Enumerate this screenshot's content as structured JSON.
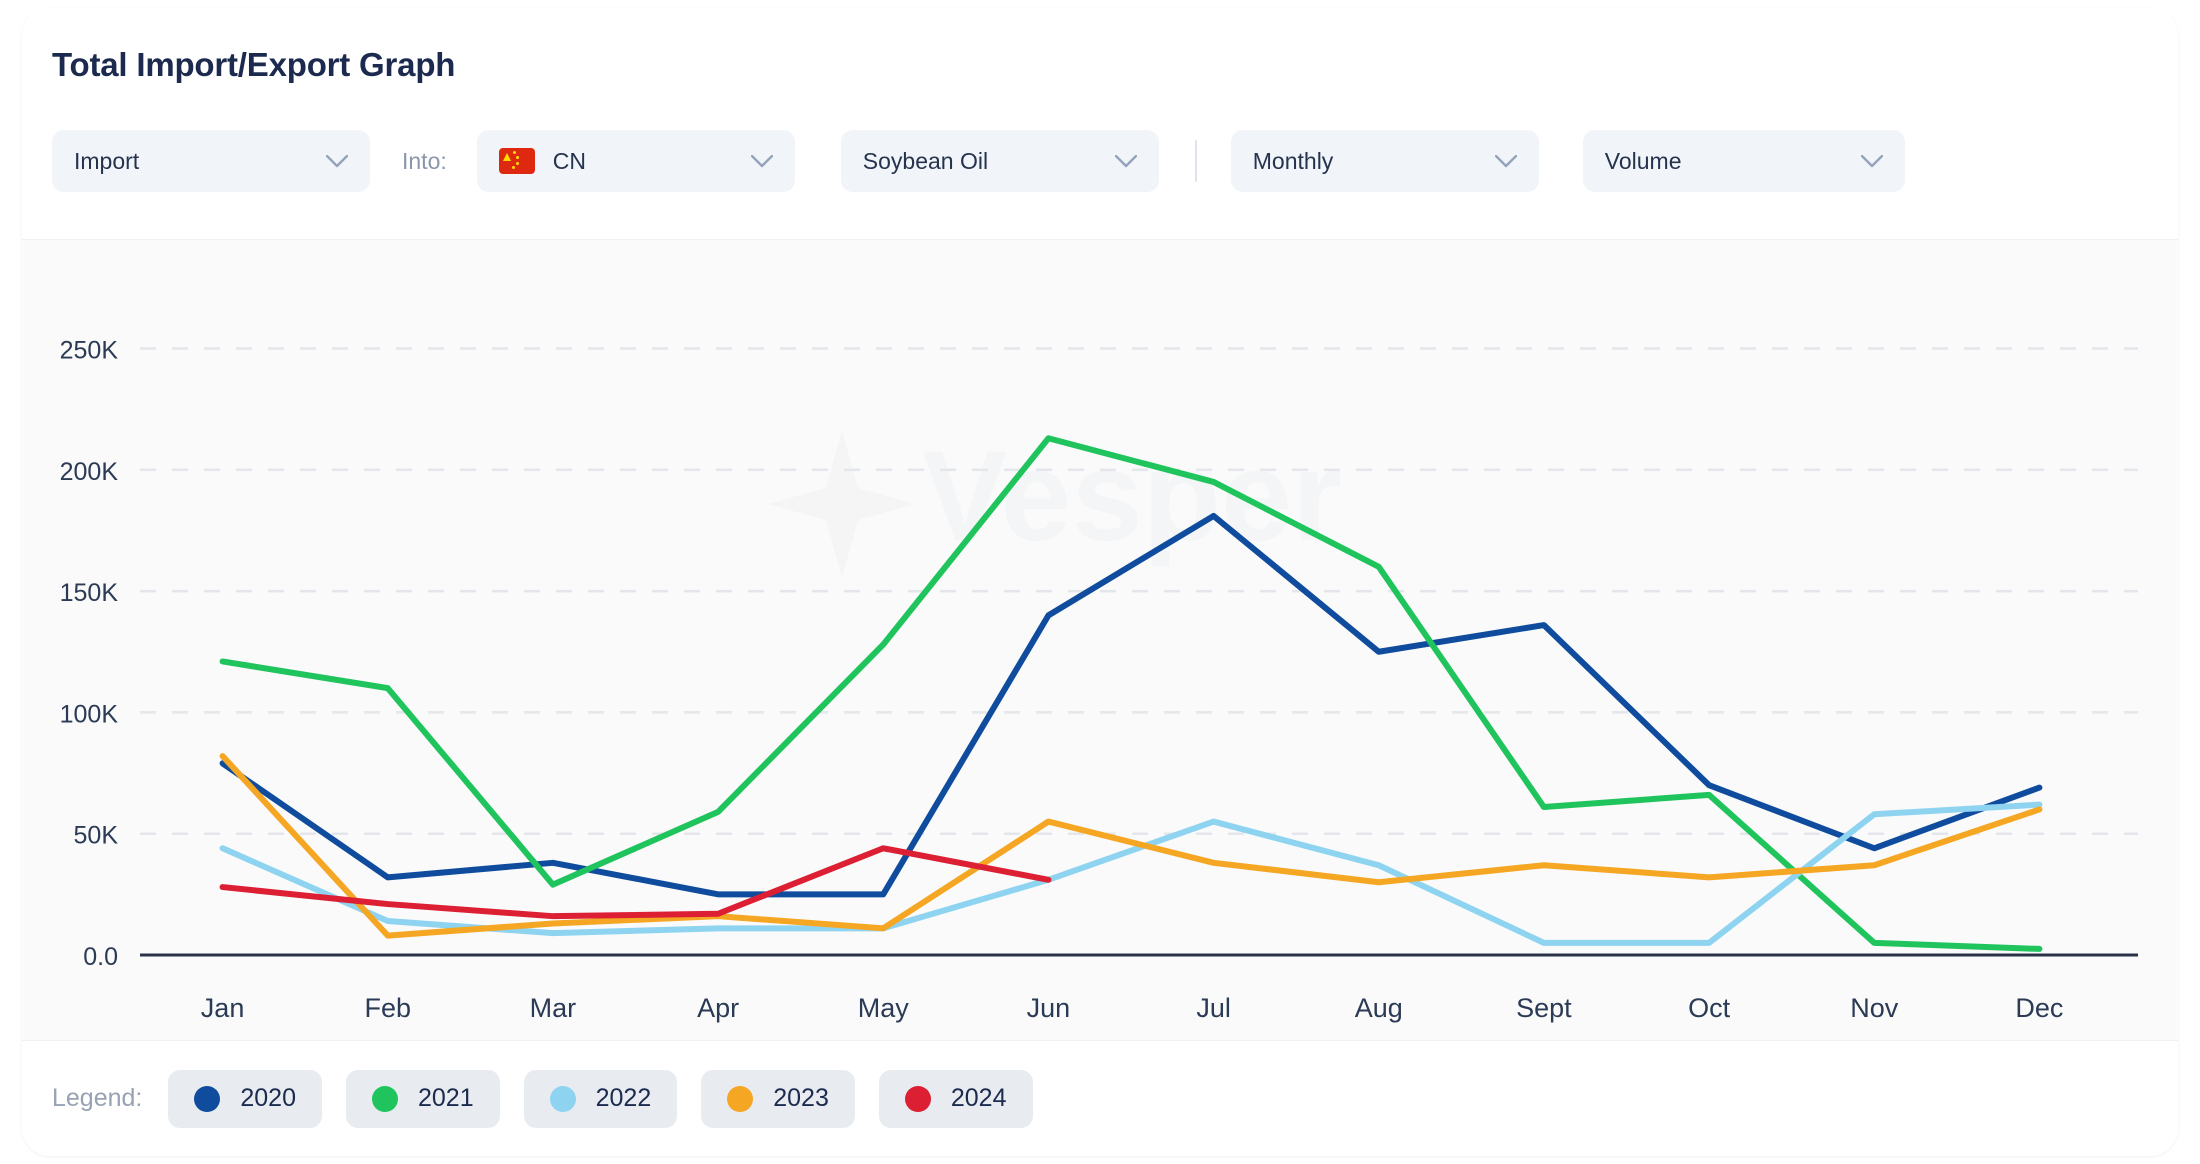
{
  "header": {
    "title": "Total Import/Export Graph",
    "into_label": "Into:"
  },
  "controls": {
    "flow": {
      "value": "Import",
      "icon": "chevron-down-icon"
    },
    "country": {
      "value": "CN",
      "flag": "cn-flag-icon",
      "icon": "chevron-down-icon"
    },
    "commodity": {
      "value": "Soybean Oil",
      "icon": "chevron-down-icon"
    },
    "frequency": {
      "value": "Monthly",
      "icon": "chevron-down-icon"
    },
    "unit": {
      "value": "Volume",
      "icon": "chevron-down-icon"
    }
  },
  "legend": {
    "label": "Legend:",
    "items": [
      {
        "name": "2020",
        "color": "#0f4c9e"
      },
      {
        "name": "2021",
        "color": "#20c45d"
      },
      {
        "name": "2022",
        "color": "#8ed4f0"
      },
      {
        "name": "2023",
        "color": "#f5a623"
      },
      {
        "name": "2024",
        "color": "#dc1f33"
      }
    ]
  },
  "watermark": {
    "text": "Vesper"
  },
  "chart_data": {
    "type": "line",
    "title": "Total Import/Export Graph",
    "xlabel": "",
    "ylabel": "",
    "ylim": [
      0,
      270000
    ],
    "yticks": [
      0,
      50000,
      100000,
      150000,
      200000,
      250000
    ],
    "ytick_labels": [
      "0.0",
      "50K",
      "100K",
      "150K",
      "200K",
      "250K"
    ],
    "grid": true,
    "legend_position": "bottom",
    "categories": [
      "Jan",
      "Feb",
      "Mar",
      "Apr",
      "May",
      "Jun",
      "Jul",
      "Aug",
      "Sept",
      "Oct",
      "Nov",
      "Dec"
    ],
    "series": [
      {
        "name": "2020",
        "color": "#0f4c9e",
        "values": [
          79000,
          32000,
          38000,
          25000,
          25000,
          140000,
          181000,
          125000,
          136000,
          70000,
          44000,
          69000
        ]
      },
      {
        "name": "2021",
        "color": "#20c45d",
        "values": [
          121000,
          110000,
          29000,
          59000,
          128000,
          213000,
          195000,
          160000,
          61000,
          66000,
          5000,
          2500
        ]
      },
      {
        "name": "2022",
        "color": "#8ed4f0",
        "values": [
          44000,
          14000,
          9000,
          11000,
          11000,
          31000,
          55000,
          37000,
          5000,
          5000,
          58000,
          62000
        ]
      },
      {
        "name": "2023",
        "color": "#f5a623",
        "values": [
          82000,
          8000,
          13000,
          16000,
          11000,
          55000,
          38000,
          30000,
          37000,
          32000,
          37000,
          60000
        ]
      },
      {
        "name": "2024",
        "color": "#dc1f33",
        "values": [
          28000,
          21000,
          16000,
          17000,
          44000,
          31000,
          null,
          null,
          null,
          null,
          null,
          null
        ]
      }
    ]
  }
}
